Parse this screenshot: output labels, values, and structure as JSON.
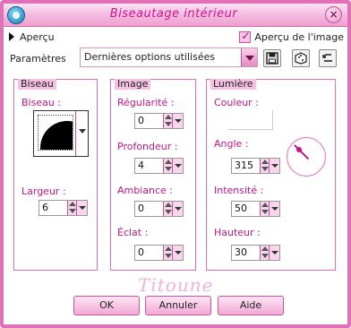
{
  "window": {
    "title": "Biseautage intérieur",
    "close_glyph": "×"
  },
  "preview": {
    "toggle_label": "Aperçu",
    "image_preview_label": "Aperçu de l'image",
    "image_preview_checked": true
  },
  "params": {
    "label": "Paramètres",
    "preset_value": "Dernières options utilisées"
  },
  "groups": {
    "bevel": {
      "title": "Biseau",
      "bevel_label": "Biseau :",
      "width_label": "Largeur :",
      "width_value": "6"
    },
    "image": {
      "title": "Image",
      "regularity_label": "Régularité :",
      "regularity_value": "0",
      "depth_label": "Profondeur :",
      "depth_value": "4",
      "ambiance_label": "Ambiance :",
      "ambiance_value": "0",
      "shine_label": "Éclat :",
      "shine_value": "0"
    },
    "light": {
      "title": "Lumière",
      "color_label": "Couleur :",
      "angle_label": "Angle :",
      "angle_value": "315",
      "intensity_label": "Intensité :",
      "intensity_value": "50",
      "height_label": "Hauteur :",
      "height_value": "30"
    }
  },
  "watermark": "Titoune",
  "buttons": {
    "ok": "OK",
    "cancel": "Annuler",
    "help": "Aide"
  },
  "colors": {
    "accent": "#e070b8",
    "title_text": "#d4148c",
    "label_text": "#c01888"
  }
}
